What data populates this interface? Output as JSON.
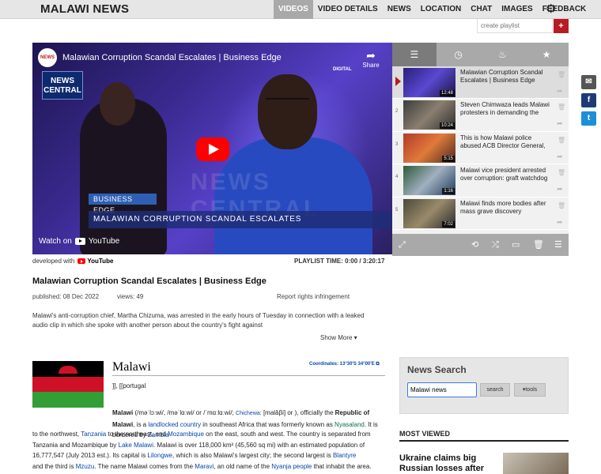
{
  "header": {
    "logo": "MALAWI NEWS",
    "nav": [
      "VIDEOS",
      "VIDEO DETAILS",
      "NEWS",
      "LOCATION",
      "CHAT",
      "IMAGES",
      "FEEDBACK"
    ],
    "active_nav": "VIDEOS",
    "gear_icon": "gear-icon"
  },
  "playlist_form": {
    "placeholder": "create playlist",
    "add_label": "+"
  },
  "video": {
    "title": "Malawian Corruption Scandal Escalates | Business Edge",
    "channel_avatar": "NEWS",
    "share_label": "Share",
    "digital_label": "DIGITAL",
    "logo_text": "NEWS CENTRAL",
    "watermark": "NEWS CENTRAL",
    "badge": "BUSINESS EDGE",
    "lower_third": "MALAWIAN CORRUPTION SCANDAL ESCALATES",
    "watch_on": "Watch on",
    "youtube": "YouTube"
  },
  "playlist": {
    "tab_icons": [
      "list-icon",
      "clock-icon",
      "fire-icon",
      "star-icon"
    ],
    "items": [
      {
        "num": "1",
        "title": "Malawian Corruption Scandal Escalates | Business Edge",
        "duration": "12:48",
        "current": true
      },
      {
        "num": "2",
        "title": "Steven Chimwaza leads Malawi protesters in demanding the",
        "duration": "10:24",
        "current": false
      },
      {
        "num": "3",
        "title": "This is how Malawi police abused ACB Director General, Martha",
        "duration": "5:15",
        "current": false
      },
      {
        "num": "4",
        "title": "Malawi vice president arrested over corruption: graft watchdog",
        "duration": "1:16",
        "current": false
      },
      {
        "num": "5",
        "title": "Malawi finds more bodies after mass grave discovery",
        "duration": "7:02",
        "current": false
      }
    ],
    "controls": [
      "expand-icon",
      "repeat-icon",
      "shuffle-icon",
      "screen-icon",
      "trash-icon",
      "list-icon"
    ]
  },
  "side_buttons": [
    "email-icon",
    "facebook-icon",
    "twitter-icon"
  ],
  "side_labels": {
    "email": "✉",
    "facebook": "f",
    "twitter": "t"
  },
  "developed_with": "developed with",
  "youtube_label": "YouTube",
  "playlist_time": "PLAYLIST TIME: 0:00 / 3:20:17",
  "article": {
    "title": "Malawian Corruption Scandal Escalates | Business Edge",
    "published": "published: 08 Dec 2022",
    "views": "views: 49",
    "report": "Report rights infringement",
    "description": "Malawi's anti-corruption chief, Martha Chizuma, was arrested in the early hours of Tuesday in connection with a leaked audio clip in which she spoke with another person about the country's fight against",
    "show_more": "Show More ▾"
  },
  "wiki": {
    "title": "Malawi",
    "coordinates": "Coordinates: 13°30′S 34°00′E ⧉",
    "portugal": "]], [[portugal",
    "t1": "Malawi",
    "t2": " (/məˈlɔːwi/, /məˈlɑːwi/ or /ˈmɑːlɑːwi/; ",
    "t3": "Chichewa:",
    "t4": " [malǎβi] or ), officially the ",
    "t5": "Republic of",
    "t6": "Malawi",
    "t7": ", is a ",
    "l1": "landlocked country",
    "t8": " in southeast Africa that was formerly known as ",
    "l2": "Nyasaland",
    "t9": ". It is bordered by ",
    "l3": "Zambia",
    "r1": "to the northwest, ",
    "l4": "Tanzania",
    "r2": " to the northeast, and ",
    "l5": "Mozambique",
    "r3": " on the east, south and west. The country is separated from Tanzania and Mozambique by ",
    "l6": "Lake Malawi",
    "r4": ". Malawi is over 118,000 km² (45,560 sq mi) with an estimated population of 16,777,547 (July 2013 est.). Its capital is ",
    "l7": "Lilongwe",
    "r5": ", which is also Malawi's largest city; the second largest is ",
    "l8": "Blantyre",
    "r6": "and the third is ",
    "l9": "Mzuzu",
    "r7": ". The name Malawi comes from the ",
    "l10": "Maravi",
    "r8": ", an old name of the ",
    "l11": "Nyanja people",
    "r9": " that inhabit the area."
  },
  "news_search": {
    "title": "News Search",
    "query": "Malawi news",
    "search_label": "search",
    "tools_label": "▾tools"
  },
  "most_viewed": {
    "title": "MOST VIEWED",
    "item": "Ukraine claims big Russian losses after"
  }
}
